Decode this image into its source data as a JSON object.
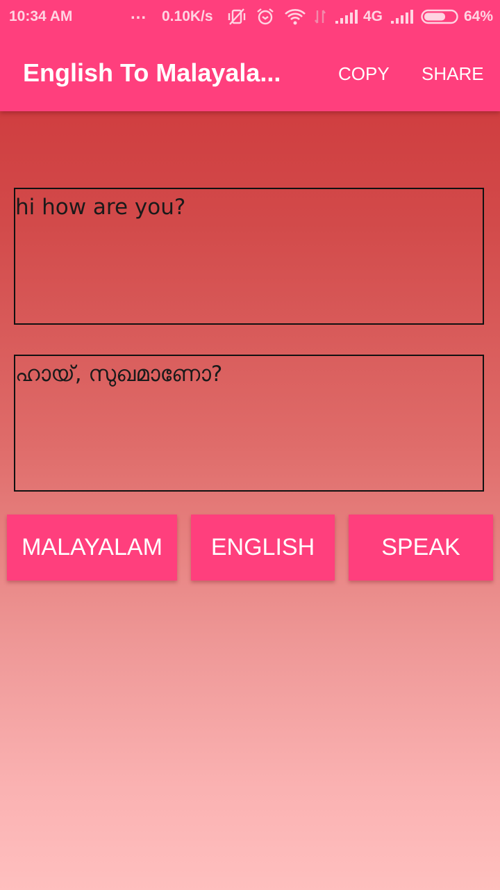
{
  "status_bar": {
    "time": "10:34 AM",
    "notification_dots": "...",
    "network_speed": "0.10K/s",
    "icons": [
      "vibrate-off-icon",
      "alarm-icon",
      "wifi-icon",
      "data-transfer-icon",
      "signal-icon",
      "signal-icon-2",
      "battery-icon"
    ],
    "network_type": "4G",
    "battery_percent": "64%",
    "battery_level": 0.64
  },
  "app_bar": {
    "title": "English To Malayala...",
    "actions": {
      "copy": "COPY",
      "share": "SHARE"
    },
    "color": "#ff3f7d"
  },
  "input": {
    "value": "hi how are you?"
  },
  "output": {
    "value": "ഹായ്, സുഖമാണോ?"
  },
  "buttons": {
    "malayalam": "MALAYALAM",
    "english": "ENGLISH",
    "speak": "SPEAK"
  }
}
